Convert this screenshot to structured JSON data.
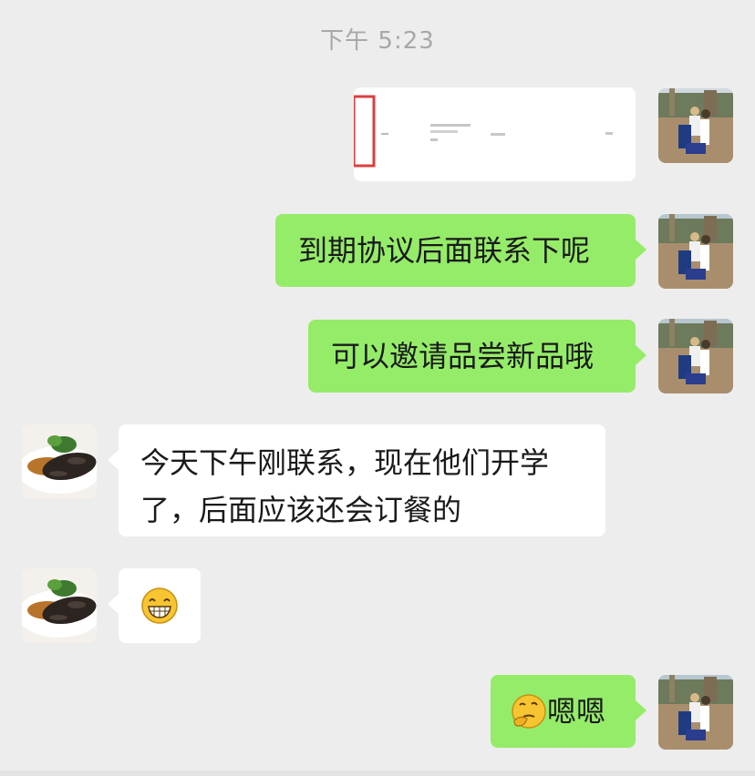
{
  "chat": {
    "timestamp": "下午 5:23",
    "messages": [
      {
        "side": "right",
        "type": "image",
        "avatar": "me-avatar-photo"
      },
      {
        "side": "right",
        "type": "text",
        "text": "到期协议后面联系下呢"
      },
      {
        "side": "right",
        "type": "text",
        "text": "可以邀请品尝新品哦"
      },
      {
        "side": "left",
        "type": "text",
        "text": "今天下午刚联系，现在他们开学了，后面应该还会订餐的",
        "line1": "今天下午刚联系，现在他们开学",
        "line2": "了，后面应该还会订餐的"
      },
      {
        "side": "left",
        "type": "emoji",
        "emoji": "grin-emoji"
      },
      {
        "side": "right",
        "type": "text",
        "text": "嗯嗯",
        "emoji": "thinking-face-emoji"
      }
    ]
  },
  "colors": {
    "background": "#ededed",
    "bubble_sent": "#95ec69",
    "bubble_received": "#ffffff",
    "timestamp_text": "#a8a8a8"
  }
}
